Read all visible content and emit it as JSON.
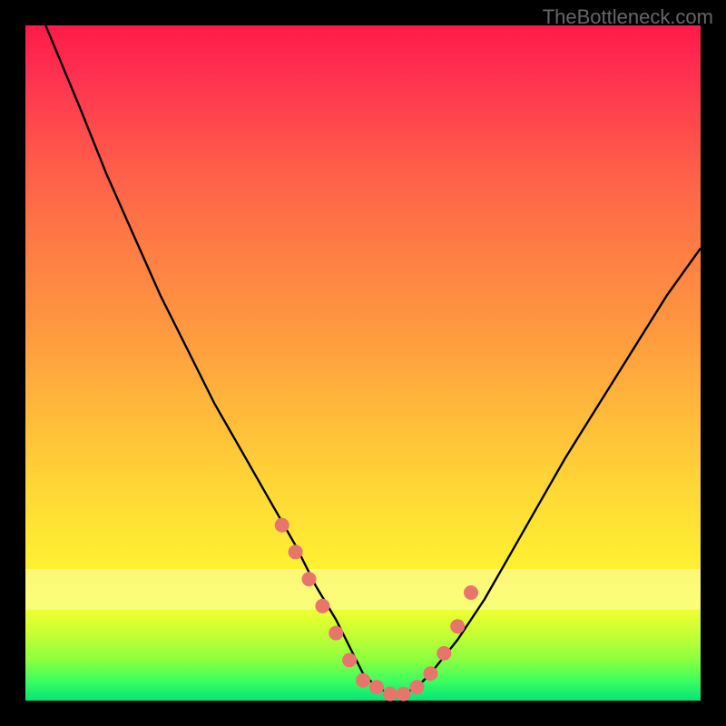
{
  "watermark": "TheBottleneck.com",
  "chart_data": {
    "type": "line",
    "title": "",
    "xlabel": "",
    "ylabel": "",
    "xlim": [
      0,
      100
    ],
    "ylim": [
      0,
      100
    ],
    "grid": false,
    "series": [
      {
        "name": "bottleneck-curve",
        "x": [
          3,
          8,
          12,
          16,
          20,
          24,
          28,
          32,
          36,
          40,
          43,
          46,
          48,
          50,
          52,
          54,
          56,
          58,
          60,
          64,
          68,
          72,
          76,
          80,
          85,
          90,
          95,
          100
        ],
        "y": [
          100,
          88,
          78,
          69,
          60,
          52,
          44,
          37,
          30,
          23,
          17,
          12,
          8,
          4,
          2,
          1,
          1,
          2,
          4,
          9,
          15,
          22,
          29,
          36,
          44,
          52,
          60,
          67
        ],
        "color": "#000000"
      }
    ],
    "markers": {
      "name": "highlighted-points",
      "color": "#e8756b",
      "x": [
        38,
        40,
        42,
        44,
        46,
        48,
        50,
        52,
        54,
        56,
        58,
        60,
        62,
        64,
        66
      ],
      "y": [
        26,
        22,
        18,
        14,
        10,
        6,
        3,
        2,
        1,
        1,
        2,
        4,
        7,
        11,
        16
      ]
    },
    "background_gradient": {
      "top": "#ff1a4a",
      "middle": "#ffd636",
      "bottom": "#00e676"
    }
  }
}
